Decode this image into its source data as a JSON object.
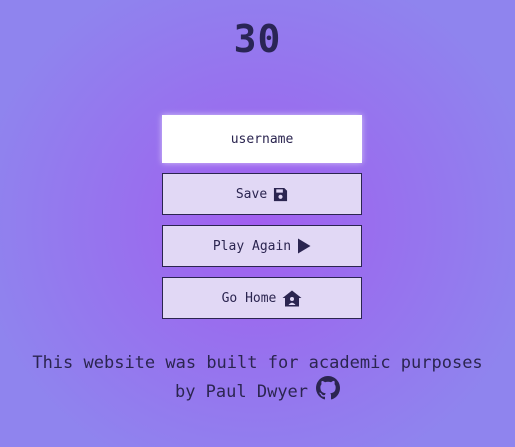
{
  "score": "30",
  "username_input": {
    "placeholder": "username",
    "value": ""
  },
  "buttons": {
    "save_label": "Save",
    "save_icon": "floppy-disk-icon",
    "play_again_label": "Play Again",
    "play_again_icon": "play-icon",
    "go_home_label": "Go Home",
    "go_home_icon": "house-user-icon"
  },
  "footer": {
    "line1": "This website was built for academic purposes",
    "line2": "by Paul Dwyer",
    "link_icon": "github-icon"
  },
  "colors": {
    "background_center": "#a25ef0",
    "background_edge": "#8f84ee",
    "text": "#2b2550",
    "button_bg": "#e1d8f5",
    "input_bg": "#ffffff"
  }
}
